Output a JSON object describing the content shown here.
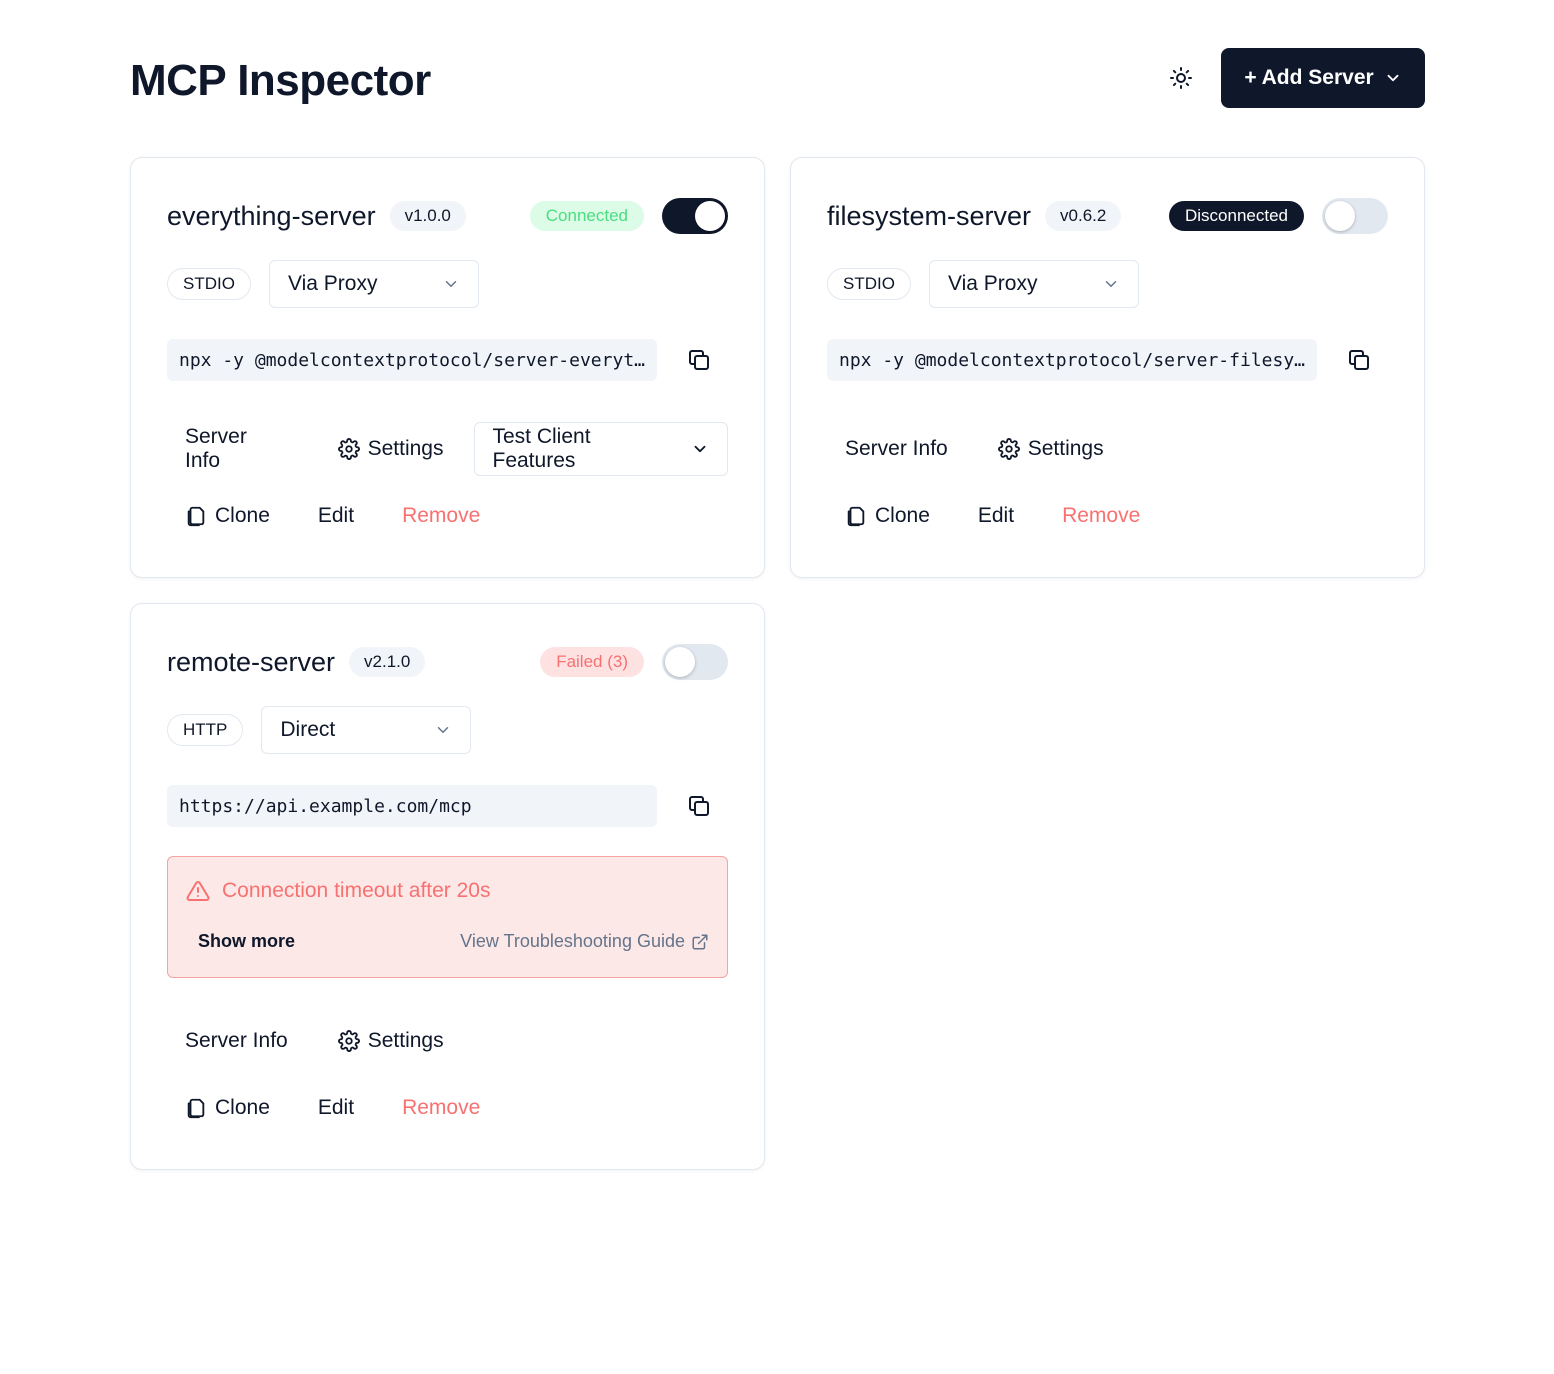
{
  "header": {
    "title": "MCP Inspector",
    "add_server_label": "+ Add Server",
    "theme_icon": "sun-icon"
  },
  "servers": [
    {
      "name": "everything-server",
      "version": "v1.0.0",
      "status": "Connected",
      "enabled": true,
      "transport": "STDIO",
      "connection_mode": "Via Proxy",
      "command": "npx -y @modelcontextprotocol/server-everything",
      "actions": {
        "server_info": "Server Info",
        "settings": "Settings",
        "test_client": "Test Client Features",
        "clone": "Clone",
        "edit": "Edit",
        "remove": "Remove"
      }
    },
    {
      "name": "filesystem-server",
      "version": "v0.6.2",
      "status": "Disconnected",
      "enabled": false,
      "transport": "STDIO",
      "connection_mode": "Via Proxy",
      "command": "npx -y @modelcontextprotocol/server-filesystem",
      "actions": {
        "server_info": "Server Info",
        "settings": "Settings",
        "clone": "Clone",
        "edit": "Edit",
        "remove": "Remove"
      }
    },
    {
      "name": "remote-server",
      "version": "v2.1.0",
      "status": "Failed (3)",
      "enabled": false,
      "transport": "HTTP",
      "connection_mode": "Direct",
      "command": "https://api.example.com/mcp",
      "error": {
        "message": "Connection timeout after 20s",
        "show_more": "Show more",
        "guide_link": "View Troubleshooting Guide"
      },
      "actions": {
        "server_info": "Server Info",
        "settings": "Settings",
        "clone": "Clone",
        "edit": "Edit",
        "remove": "Remove"
      }
    }
  ],
  "colors": {
    "primary": "#0f172a",
    "connected_bg": "#dcfce7",
    "connected_text": "#4ade80",
    "failed_bg": "#fee2e2",
    "failed_text": "#f87171",
    "remove_text": "#f87171",
    "code_bg": "#f1f5f9"
  }
}
